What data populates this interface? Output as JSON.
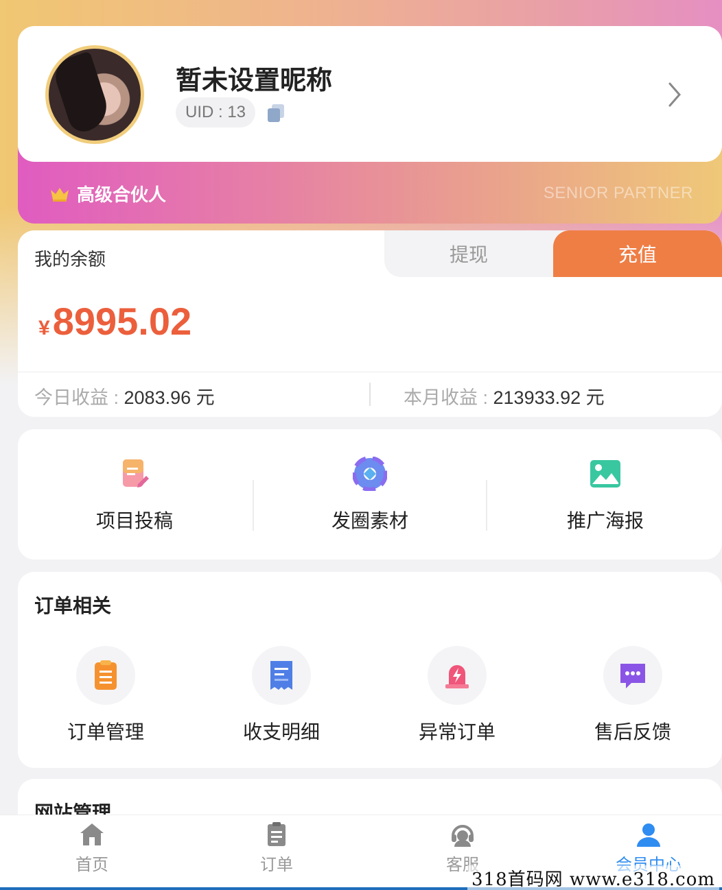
{
  "profile": {
    "nickname": "暂未设置昵称",
    "uid": "UID : 13",
    "level_cn": "高级合伙人",
    "level_en": "SENIOR PARTNER"
  },
  "balance": {
    "title": "我的余额",
    "withdraw_label": "提现",
    "recharge_label": "充值",
    "currency_symbol": "¥",
    "amount": "8995.02",
    "today_label": "今日收益 : ",
    "today_value": "2083.96 元",
    "month_label": "本月收益 : ",
    "month_value": "213933.92 元"
  },
  "tools": [
    {
      "label": "项目投稿",
      "icon": "edit-document-icon"
    },
    {
      "label": "发圈素材",
      "icon": "aperture-icon"
    },
    {
      "label": "推广海报",
      "icon": "image-icon"
    }
  ],
  "orders": {
    "title": "订单相关",
    "items": [
      {
        "label": "订单管理",
        "icon": "order-list-icon"
      },
      {
        "label": "收支明细",
        "icon": "receipt-icon"
      },
      {
        "label": "异常订单",
        "icon": "alarm-icon"
      },
      {
        "label": "售后反馈",
        "icon": "chat-icon"
      }
    ]
  },
  "site": {
    "title": "网站管理"
  },
  "tabbar": [
    {
      "label": "首页",
      "icon": "home-icon"
    },
    {
      "label": "订单",
      "icon": "clipboard-icon"
    },
    {
      "label": "客服",
      "icon": "headset-icon"
    },
    {
      "label": "会员中心",
      "icon": "user-icon"
    }
  ],
  "watermark": "318首码网  www.e318.com",
  "colors": {
    "accent": "#ef7e45",
    "amount": "#ec5f3c",
    "active_tab": "#2f8cf0"
  }
}
